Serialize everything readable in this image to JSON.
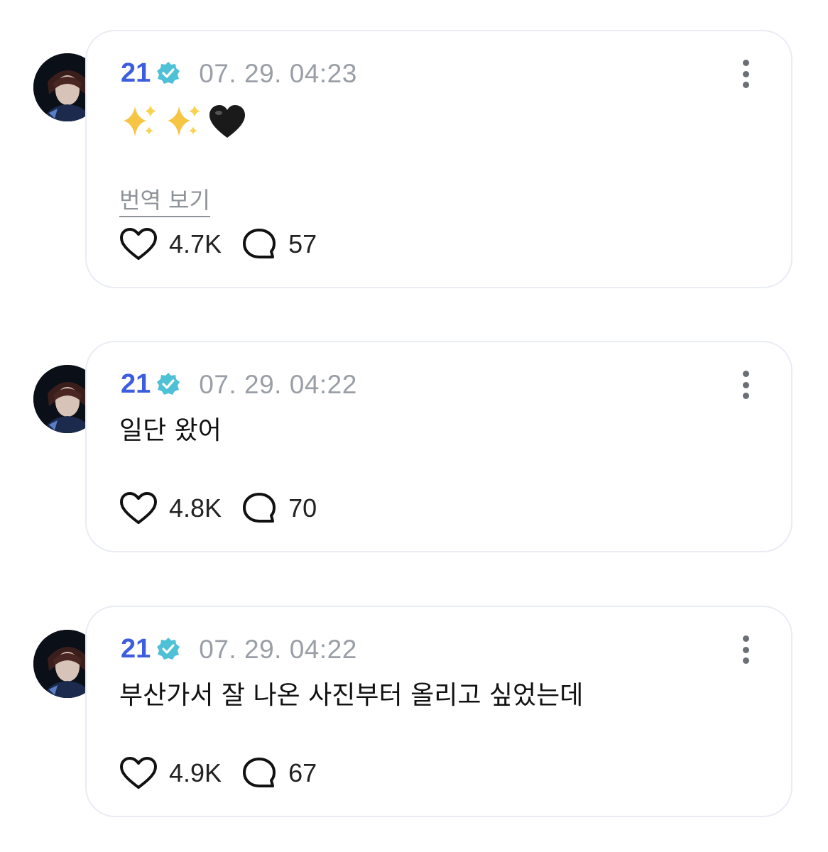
{
  "posts": [
    {
      "username": "21",
      "verified": true,
      "timestamp": "07. 29. 04:23",
      "content": "✨✨🖤",
      "content_glyphs": [
        "sparkles-icon",
        "sparkles-icon",
        "black-heart-icon"
      ],
      "translate_label": "번역 보기",
      "likes": "4.7K",
      "replies": "57"
    },
    {
      "username": "21",
      "verified": true,
      "timestamp": "07. 29. 04:22",
      "content": "일단 왔어",
      "likes": "4.8K",
      "replies": "70"
    },
    {
      "username": "21",
      "verified": true,
      "timestamp": "07. 29. 04:22",
      "content": "부산가서 잘 나온 사진부터 올리고 싶었는데",
      "likes": "4.9K",
      "replies": "67"
    }
  ],
  "colors": {
    "username": "#3d5de0",
    "badge": "#4fc1d6",
    "timestamp": "#9a9ea6",
    "card_border": "#e9ecf3"
  },
  "icons": {
    "like": "heart-outline-icon",
    "reply": "speech-bubble-outline-icon",
    "more": "vertical-ellipsis-icon",
    "badge": "verified-badge-icon"
  }
}
